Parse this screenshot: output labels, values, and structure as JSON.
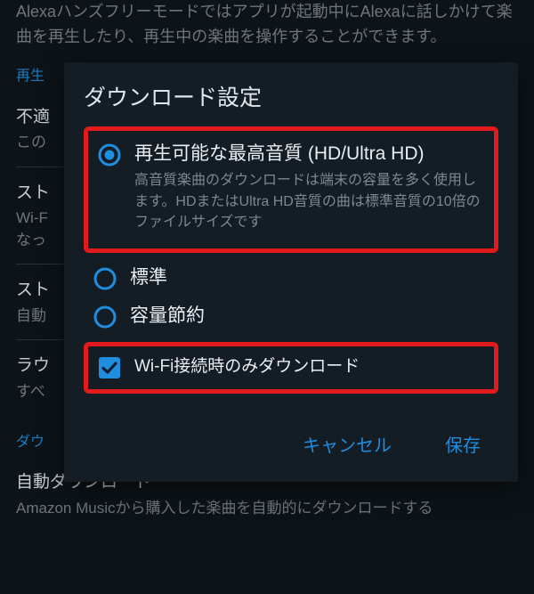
{
  "background": {
    "top_text": "Alexaハンズフリーモードではアプリが起動中にAlexaに話しかけて楽曲を再生したり、再生中の楽曲を操作することができます。",
    "sections": [
      {
        "label": "再生"
      },
      {
        "title": "不適",
        "sub": "この",
        "cb": true
      },
      {
        "title": "スト",
        "sub": "Wi-F\nなっ"
      },
      {
        "title": "スト",
        "sub": "自動"
      },
      {
        "title": "ラウ",
        "sub": "すべ",
        "cb": true
      }
    ],
    "bottom_section_label": "ダウ",
    "bottom_row_title": "自動ダウンロード",
    "bottom_row_sub": "Amazon Musicから購入した楽曲を自動的にダウンロードする"
  },
  "dialog": {
    "title": "ダウンロード設定",
    "options": {
      "hd": {
        "label": "再生可能な最高音質 (HD/Ultra HD)",
        "desc": "高音質楽曲のダウンロードは端末の容量を多く使用します。HDまたはUltra HD音質の曲は標準音質の10倍のファイルサイズです"
      },
      "standard": {
        "label": "標準"
      },
      "saver": {
        "label": "容量節約"
      },
      "wifi": {
        "label": "Wi-Fi接続時のみダウンロード"
      }
    },
    "actions": {
      "cancel": "キャンセル",
      "save": "保存"
    }
  }
}
